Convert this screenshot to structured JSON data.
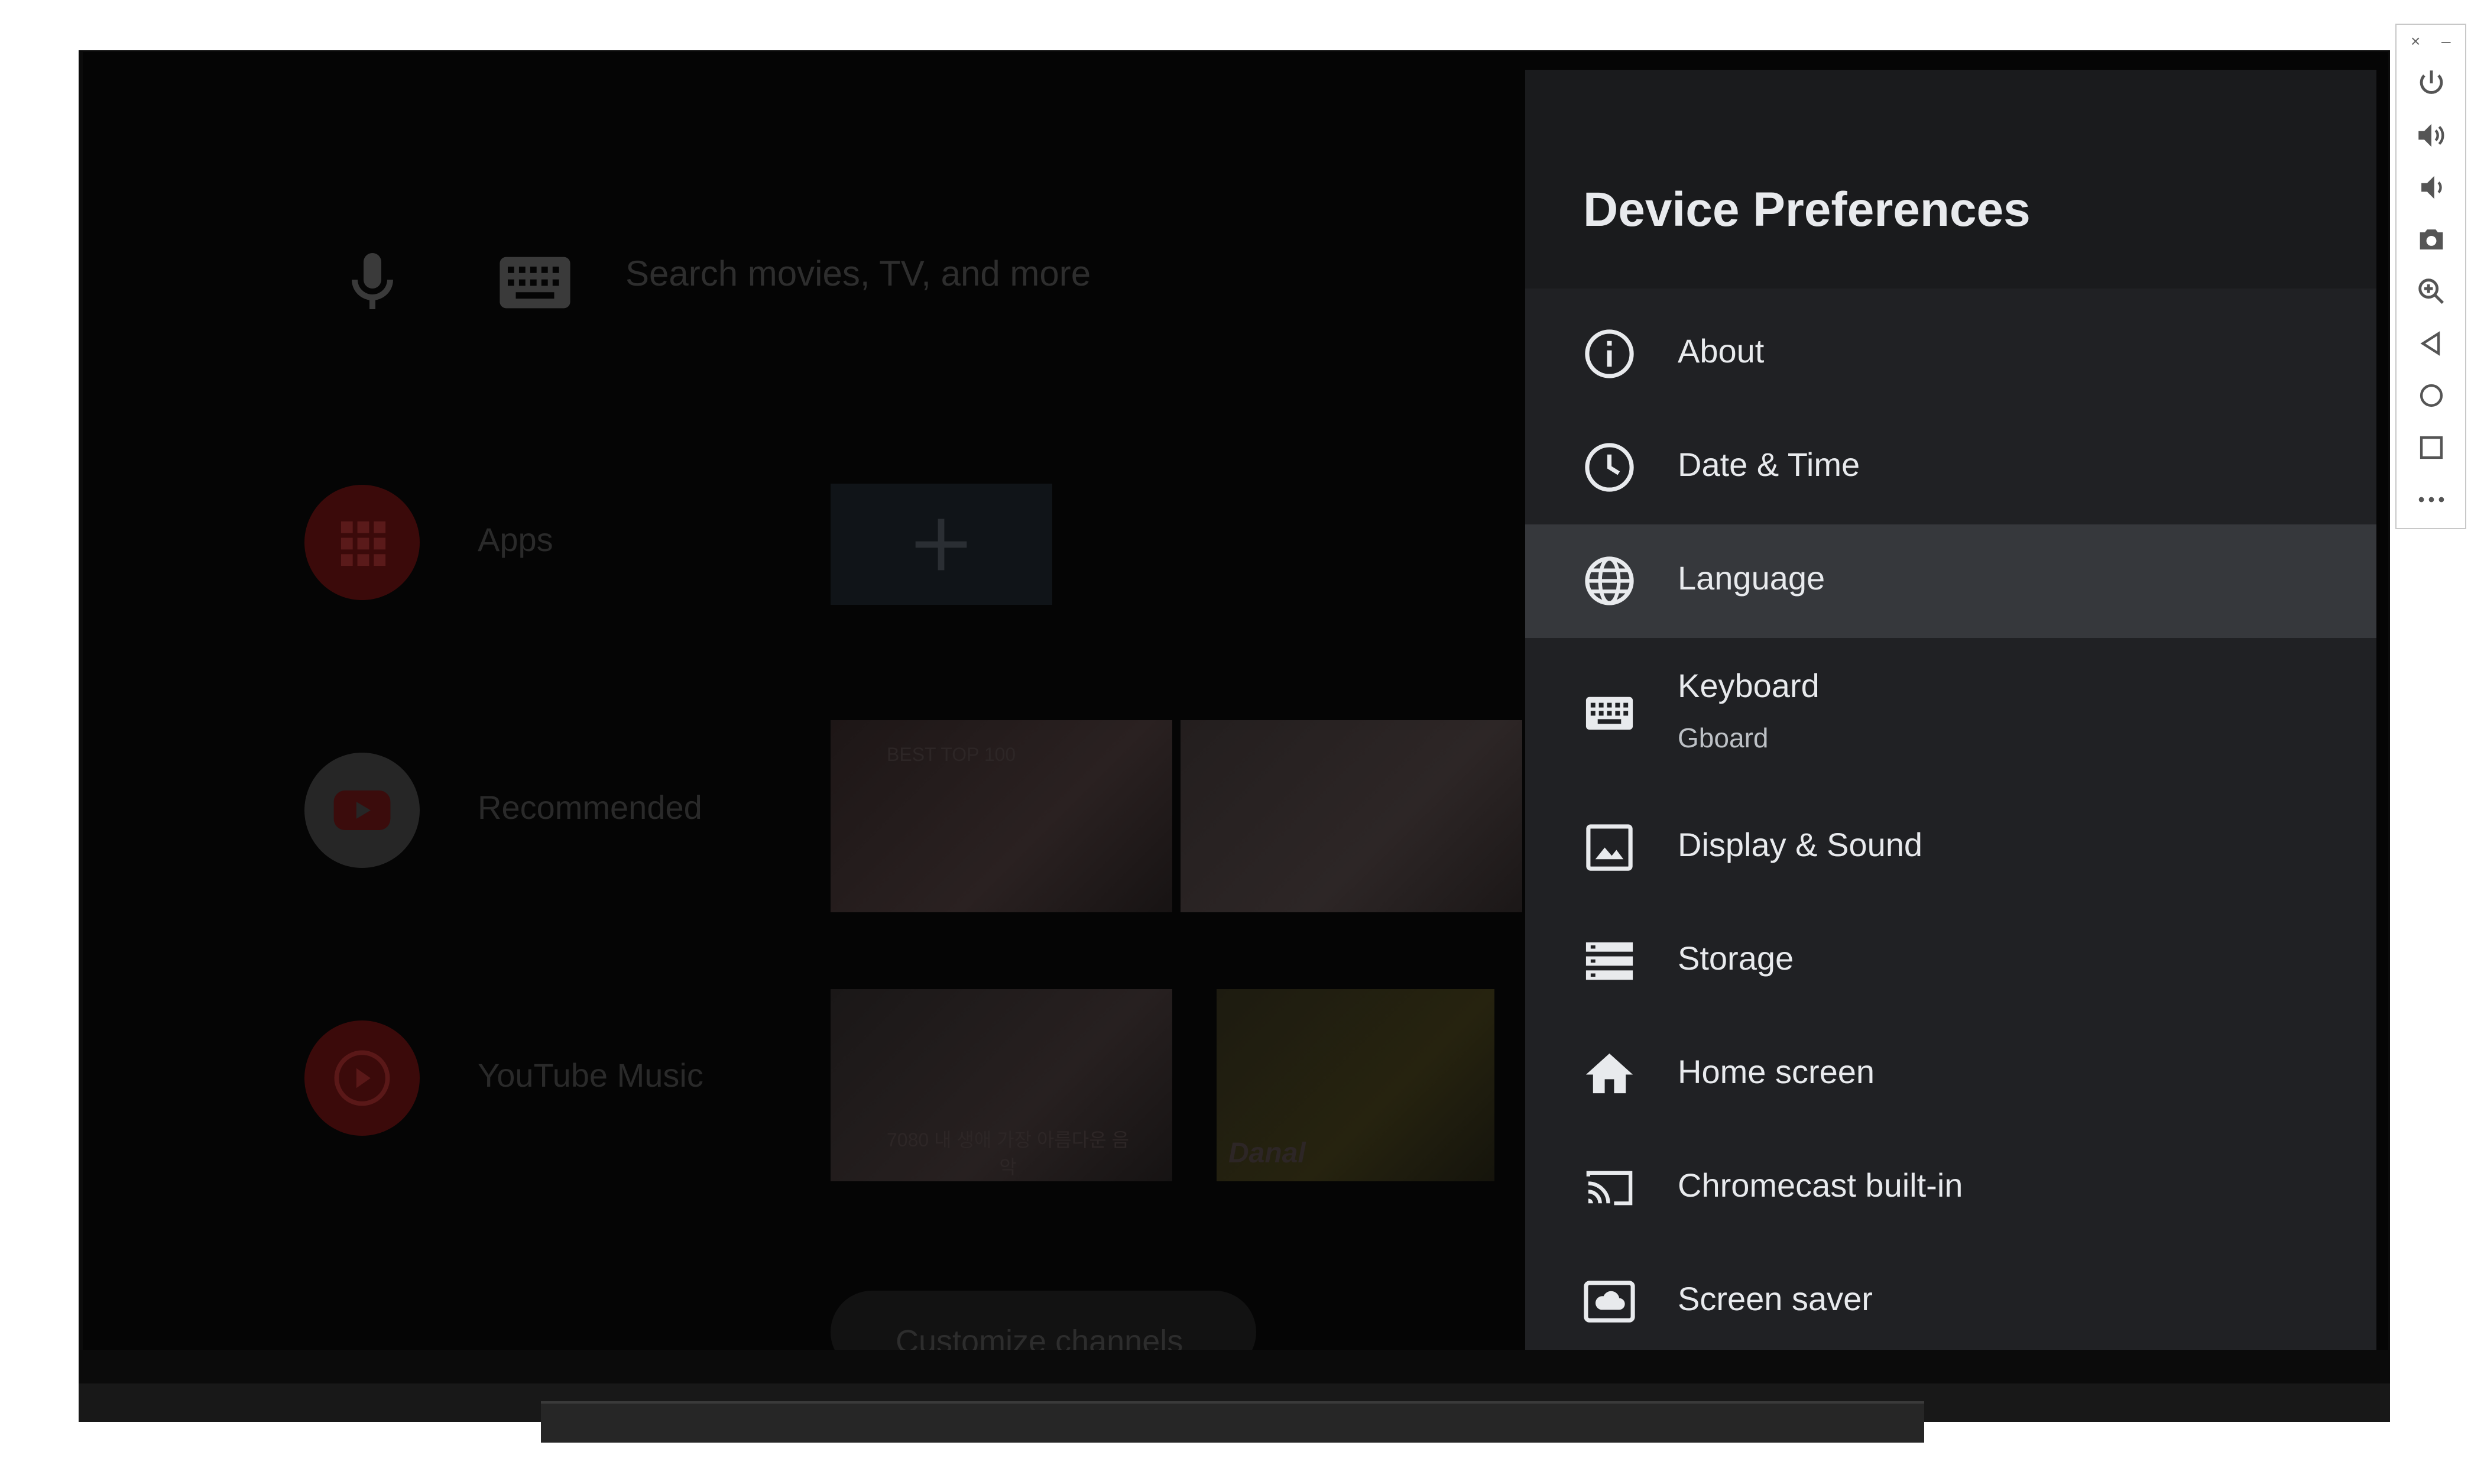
{
  "home": {
    "search_placeholder": "Search movies, TV, and more",
    "rows": {
      "apps": "Apps",
      "recommended": "Recommended",
      "youtube_music": "YouTube Music"
    },
    "customize_channels": "Customize channels",
    "thumbnails": {
      "t1_caption": "BEST TOP 100",
      "t3_caption": "7080 내 생애 가장 아름다운 음악",
      "t4_caption": "Danal"
    }
  },
  "panel": {
    "title": "Device Preferences",
    "items": [
      {
        "label": "About",
        "icon": "info-icon"
      },
      {
        "label": "Date & Time",
        "icon": "clock-icon"
      },
      {
        "label": "Language",
        "icon": "globe-icon",
        "selected": true
      },
      {
        "label": "Keyboard",
        "subtitle": "Gboard",
        "icon": "keyboard-icon"
      },
      {
        "label": "Display & Sound",
        "icon": "image-icon"
      },
      {
        "label": "Storage",
        "icon": "storage-icon"
      },
      {
        "label": "Home screen",
        "icon": "home-icon"
      },
      {
        "label": "Chromecast built-in",
        "icon": "cast-icon"
      },
      {
        "label": "Screen saver",
        "icon": "screensaver-icon"
      }
    ]
  },
  "toolbar": {
    "close": "×",
    "minimize": "–",
    "buttons": [
      "power-icon",
      "volume-up-icon",
      "volume-down-icon",
      "camera-icon",
      "zoom-icon",
      "back-icon",
      "home-circle-icon",
      "overview-icon",
      "more-icon"
    ]
  },
  "colors": {
    "panel_bg": "#202124",
    "panel_header_bg": "#1a1b1d",
    "selected_bg": "#36383c",
    "text_primary": "#e8eaed",
    "text_secondary": "#bdc1c6"
  }
}
